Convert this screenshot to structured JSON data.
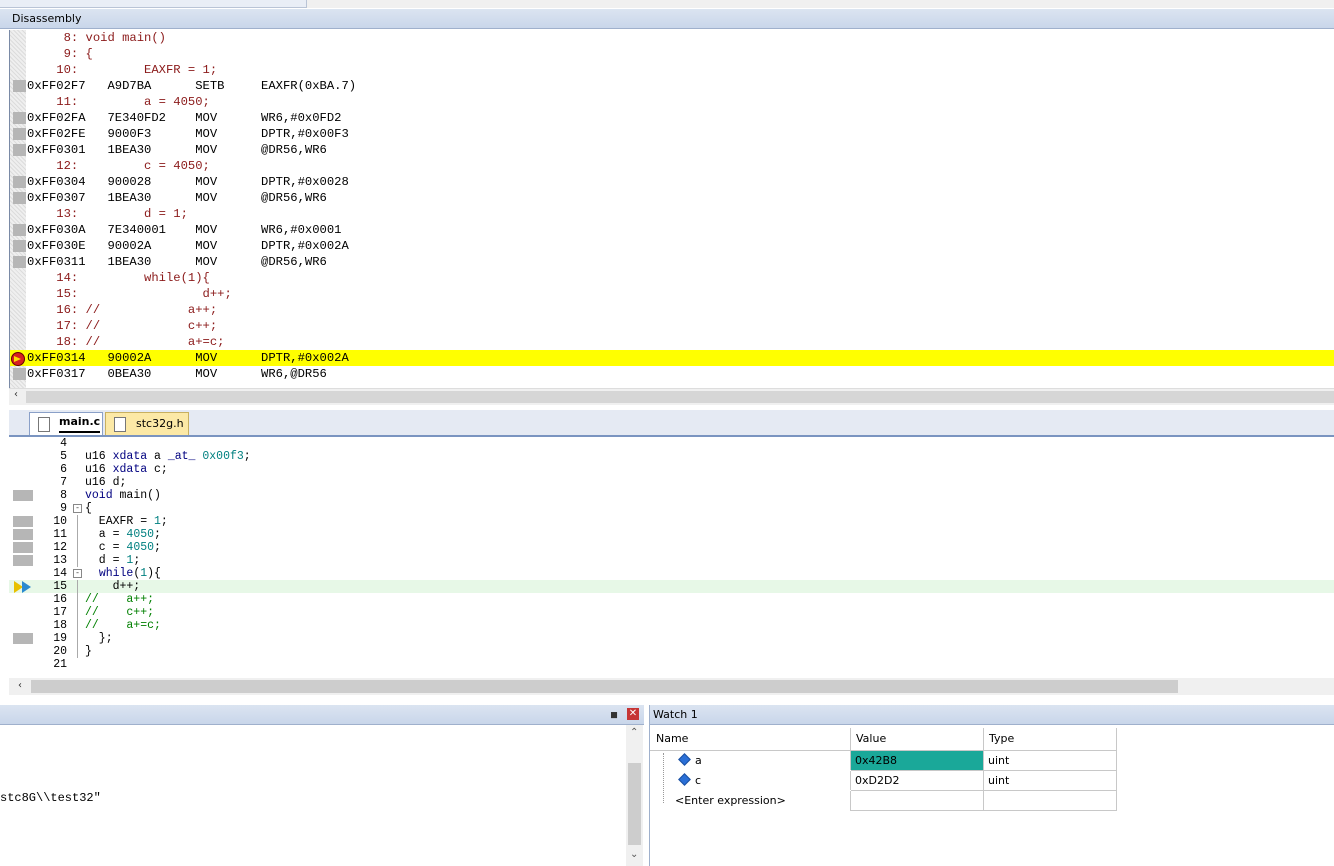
{
  "disassembly": {
    "title": "Disassembly",
    "lines": [
      {
        "kind": "src",
        "text": "     8: void main()"
      },
      {
        "kind": "src",
        "text": "     9: {"
      },
      {
        "kind": "src",
        "text": "    10:         EAXFR = 1;"
      },
      {
        "kind": "asm",
        "text": "0xFF02F7   A9D7BA      SETB     EAXFR(0xBA.7)",
        "mark": true
      },
      {
        "kind": "src",
        "text": "    11:         a = 4050;"
      },
      {
        "kind": "asm",
        "text": "0xFF02FA   7E340FD2    MOV      WR6,#0x0FD2",
        "mark": true
      },
      {
        "kind": "asm",
        "text": "0xFF02FE   9000F3      MOV      DPTR,#0x00F3",
        "mark": true
      },
      {
        "kind": "asm",
        "text": "0xFF0301   1BEA30      MOV      @DR56,WR6",
        "mark": true
      },
      {
        "kind": "src",
        "text": "    12:         c = 4050;"
      },
      {
        "kind": "asm",
        "text": "0xFF0304   900028      MOV      DPTR,#0x0028",
        "mark": true
      },
      {
        "kind": "asm",
        "text": "0xFF0307   1BEA30      MOV      @DR56,WR6",
        "mark": true
      },
      {
        "kind": "src",
        "text": "    13:         d = 1;"
      },
      {
        "kind": "asm",
        "text": "0xFF030A   7E340001    MOV      WR6,#0x0001",
        "mark": true
      },
      {
        "kind": "asm",
        "text": "0xFF030E   90002A      MOV      DPTR,#0x002A",
        "mark": true
      },
      {
        "kind": "asm",
        "text": "0xFF0311   1BEA30      MOV      @DR56,WR6",
        "mark": true
      },
      {
        "kind": "src",
        "text": "    14:         while(1){"
      },
      {
        "kind": "src",
        "text": "    15:                 d++;"
      },
      {
        "kind": "src",
        "text": "    16: //            a++;"
      },
      {
        "kind": "src",
        "text": "    17: //            c++;"
      },
      {
        "kind": "src",
        "text": "    18: //            a+=c;"
      },
      {
        "kind": "asm",
        "text": "0xFF0314   90002A      MOV      DPTR,#0x002A",
        "current": true
      },
      {
        "kind": "asm",
        "text": "0xFF0317   0BEA30      MOV      WR6,@DR56",
        "mark": true
      }
    ]
  },
  "editor": {
    "tabs": [
      {
        "label": "main.c",
        "active": true
      },
      {
        "label": "stc32g.h",
        "active": false
      }
    ],
    "lines": [
      {
        "n": "4",
        "parts": []
      },
      {
        "n": "5",
        "parts": [
          [
            "",
            "u16 "
          ],
          [
            "kw",
            "xdata"
          ],
          [
            "",
            " a "
          ],
          [
            "kw",
            "_at_"
          ],
          [
            "",
            " "
          ],
          [
            "nm",
            "0x00f3"
          ],
          [
            "",
            ";"
          ]
        ]
      },
      {
        "n": "6",
        "parts": [
          [
            "",
            "u16 "
          ],
          [
            "kw",
            "xdata"
          ],
          [
            "",
            " c;"
          ]
        ]
      },
      {
        "n": "7",
        "parts": [
          [
            "",
            "u16 d;"
          ]
        ]
      },
      {
        "n": "8",
        "parts": [
          [
            "kw",
            "void"
          ],
          [
            "",
            " main()"
          ]
        ],
        "mark": true
      },
      {
        "n": "9",
        "parts": [
          [
            "",
            "{"
          ]
        ],
        "fold": "-"
      },
      {
        "n": "10",
        "parts": [
          [
            "",
            "  EAXFR = "
          ],
          [
            "nm",
            "1"
          ],
          [
            "",
            ";"
          ]
        ],
        "mark": true
      },
      {
        "n": "11",
        "parts": [
          [
            "",
            "  a = "
          ],
          [
            "nm",
            "4050"
          ],
          [
            "",
            ";"
          ]
        ],
        "mark": true
      },
      {
        "n": "12",
        "parts": [
          [
            "",
            "  c = "
          ],
          [
            "nm",
            "4050"
          ],
          [
            "",
            ";"
          ]
        ],
        "mark": true
      },
      {
        "n": "13",
        "parts": [
          [
            "",
            "  d = "
          ],
          [
            "nm",
            "1"
          ],
          [
            "",
            ";"
          ]
        ],
        "mark": true
      },
      {
        "n": "14",
        "parts": [
          [
            "",
            "  "
          ],
          [
            "kw",
            "while"
          ],
          [
            "",
            "("
          ],
          [
            "nm",
            "1"
          ],
          [
            "",
            "){"
          ]
        ],
        "fold": "-"
      },
      {
        "n": "15",
        "parts": [
          [
            "",
            "    d++;"
          ]
        ],
        "current": true
      },
      {
        "n": "16",
        "parts": [
          [
            "cm",
            "//    a++;"
          ]
        ]
      },
      {
        "n": "17",
        "parts": [
          [
            "cm",
            "//    c++;"
          ]
        ]
      },
      {
        "n": "18",
        "parts": [
          [
            "cm",
            "//    a+=c;"
          ]
        ]
      },
      {
        "n": "19",
        "parts": [
          [
            "",
            "  };"
          ]
        ],
        "mark": true
      },
      {
        "n": "20",
        "parts": [
          [
            "",
            "}"
          ]
        ]
      },
      {
        "n": "21",
        "parts": []
      }
    ]
  },
  "output": {
    "text": "stc8G\\\\test32\""
  },
  "watch": {
    "title": "Watch 1",
    "headers": {
      "name": "Name",
      "value": "Value",
      "type": "Type"
    },
    "rows": [
      {
        "name": "a",
        "value": "0x42B8",
        "type": "uint",
        "changed": true
      },
      {
        "name": "c",
        "value": "0xD2D2",
        "type": "uint",
        "changed": false
      }
    ],
    "enter_expression": "<Enter expression>"
  },
  "colors": {
    "current_line": "#ffff00",
    "changed_value": "#1aa899",
    "panel_title": "#c9d6ea"
  }
}
